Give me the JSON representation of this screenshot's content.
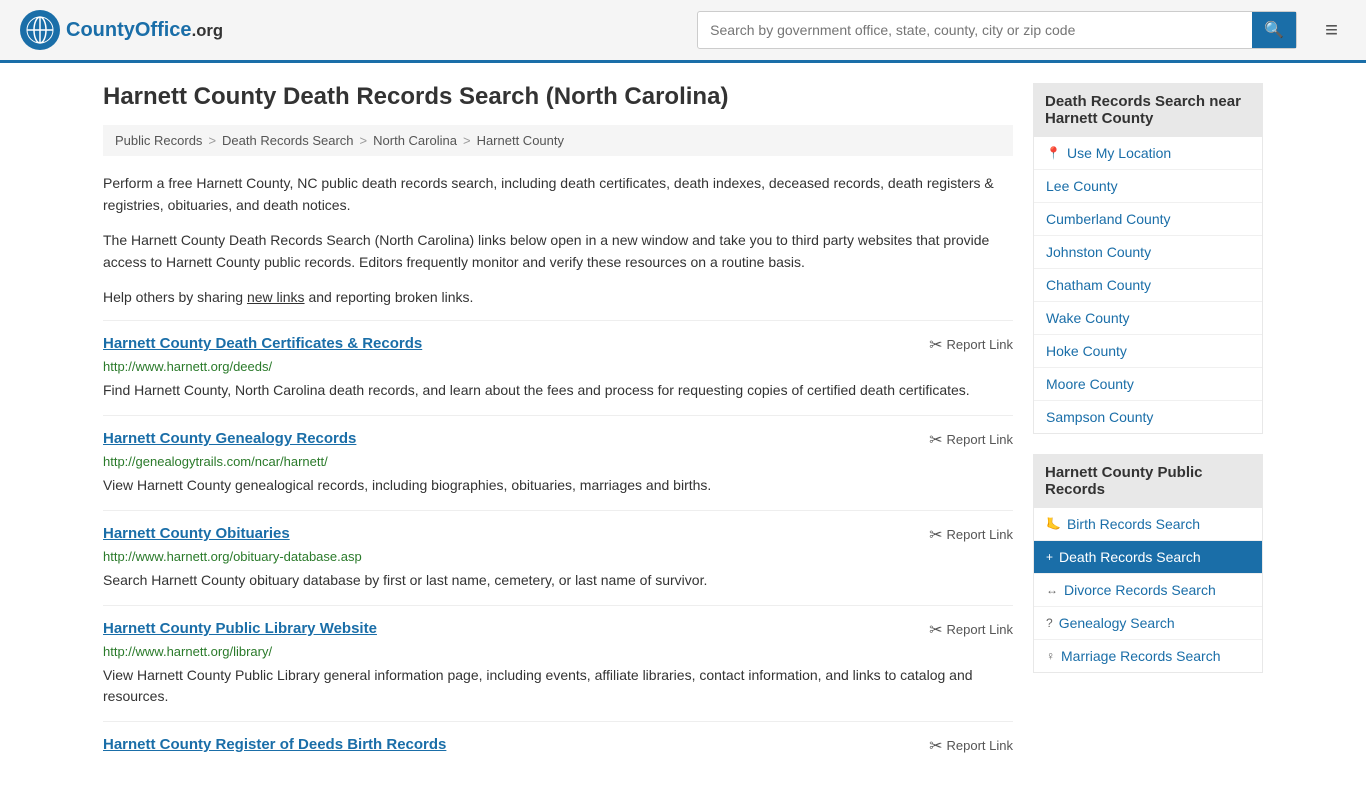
{
  "header": {
    "logo_text": "CountyOffice",
    "logo_suffix": ".org",
    "search_placeholder": "Search by government office, state, county, city or zip code",
    "menu_icon": "≡"
  },
  "page": {
    "title": "Harnett County Death Records Search (North Carolina)"
  },
  "breadcrumb": {
    "items": [
      {
        "label": "Public Records",
        "href": "#"
      },
      {
        "label": "Death Records Search",
        "href": "#"
      },
      {
        "label": "North Carolina",
        "href": "#"
      },
      {
        "label": "Harnett County",
        "href": "#"
      }
    ]
  },
  "description": {
    "para1": "Perform a free Harnett County, NC public death records search, including death certificates, death indexes, deceased records, death registers & registries, obituaries, and death notices.",
    "para2": "The Harnett County Death Records Search (North Carolina) links below open in a new window and take you to third party websites that provide access to Harnett County public records. Editors frequently monitor and verify these resources on a routine basis.",
    "para3_before": "Help others by sharing ",
    "para3_link": "new links",
    "para3_after": " and reporting broken links."
  },
  "links": [
    {
      "title": "Harnett County Death Certificates & Records",
      "url": "http://www.harnett.org/deeds/",
      "desc": "Find Harnett County, North Carolina death records, and learn about the fees and process for requesting copies of certified death certificates.",
      "report": "Report Link"
    },
    {
      "title": "Harnett County Genealogy Records",
      "url": "http://genealogytrails.com/ncar/harnett/",
      "desc": "View Harnett County genealogical records, including biographies, obituaries, marriages and births.",
      "report": "Report Link"
    },
    {
      "title": "Harnett County Obituaries",
      "url": "http://www.harnett.org/obituary-database.asp",
      "desc": "Search Harnett County obituary database by first or last name, cemetery, or last name of survivor.",
      "report": "Report Link"
    },
    {
      "title": "Harnett County Public Library Website",
      "url": "http://www.harnett.org/library/",
      "desc": "View Harnett County Public Library general information page, including events, affiliate libraries, contact information, and links to catalog and resources.",
      "report": "Report Link"
    },
    {
      "title": "Harnett County Register of Deeds Birth Records",
      "url": "",
      "desc": "",
      "report": "Report Link"
    }
  ],
  "sidebar": {
    "nearby_title": "Death Records Search near Harnett County",
    "nearby_items": [
      {
        "label": "Use My Location",
        "icon": "📍"
      },
      {
        "label": "Lee County",
        "icon": ""
      },
      {
        "label": "Cumberland County",
        "icon": ""
      },
      {
        "label": "Johnston County",
        "icon": ""
      },
      {
        "label": "Chatham County",
        "icon": ""
      },
      {
        "label": "Wake County",
        "icon": ""
      },
      {
        "label": "Hoke County",
        "icon": ""
      },
      {
        "label": "Moore County",
        "icon": ""
      },
      {
        "label": "Sampson County",
        "icon": ""
      }
    ],
    "public_records_title": "Harnett County Public Records",
    "public_records_items": [
      {
        "label": "Birth Records Search",
        "icon": "🦶",
        "active": false
      },
      {
        "label": "Death Records Search",
        "icon": "+",
        "active": true
      },
      {
        "label": "Divorce Records Search",
        "icon": "↔",
        "active": false
      },
      {
        "label": "Genealogy Search",
        "icon": "?",
        "active": false
      },
      {
        "label": "Marriage Records Search",
        "icon": "♀",
        "active": false
      }
    ]
  }
}
